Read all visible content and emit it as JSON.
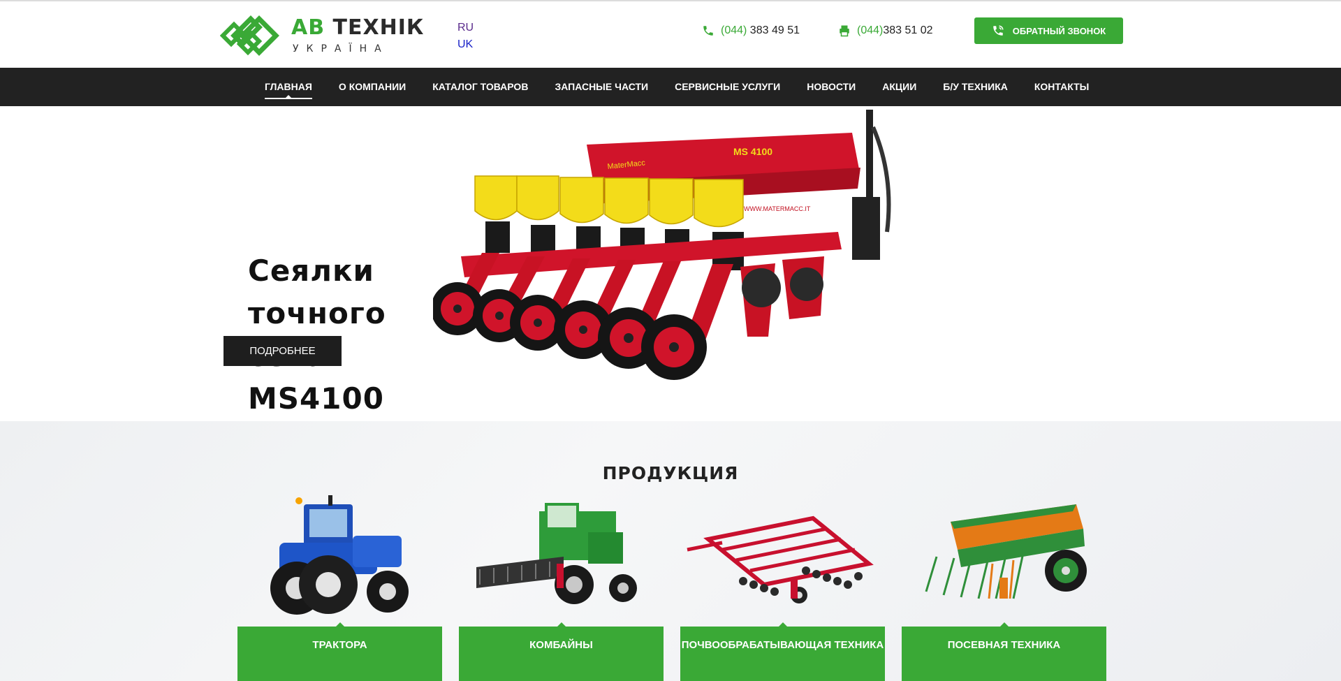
{
  "header": {
    "logo": {
      "word_accent": "АВ",
      "word_main": "ТЕХНІК",
      "sub": "УКРАЇНА",
      "icon": "logo-mark-icon"
    },
    "langs": [
      "RU",
      "UK"
    ],
    "phones": [
      {
        "code": "(044)",
        "number": " 383 49 51",
        "icon": "phone-icon"
      },
      {
        "code": "(044)",
        "number": "383 51 02",
        "icon": "fax-icon"
      }
    ],
    "callback_label": "ОБРАТНЫЙ ЗВОНОК"
  },
  "nav": {
    "items": [
      "ГЛАВНАЯ",
      "О КОМПАНИИ",
      "КАТАЛОГ ТОВАРОВ",
      "ЗАПАСНЫЕ ЧАСТИ",
      "СЕРВИСНЫЕ УСЛУГИ",
      "НОВОСТИ",
      "АКЦИИ",
      "Б/У ТЕХНИКА",
      "КОНТАКТЫ"
    ],
    "active": "ГЛАВНАЯ"
  },
  "hero": {
    "title_lines": [
      "Сеялки",
      "точного",
      "сева",
      "MS4100"
    ],
    "more_label": "ПОДРОБНЕЕ",
    "image_text": [
      "MS 4100",
      "MaterMacc",
      "WWW.MATERMACC.IT"
    ]
  },
  "products": {
    "title": "ПРОДУКЦИЯ",
    "items": [
      "ТРАКТОРА",
      "КОМБАЙНЫ",
      "ПОЧВООБРАБАТЫВАЮЩАЯ ТЕХНИКА",
      "ПОСЕВНАЯ ТЕХНИКА"
    ]
  },
  "colors": {
    "accent": "#3aa936",
    "nav_bg": "#222222",
    "hero_button": "#1e1e1e",
    "seeder_red": "#d0142a",
    "seeder_yellow": "#f3dc1a"
  }
}
